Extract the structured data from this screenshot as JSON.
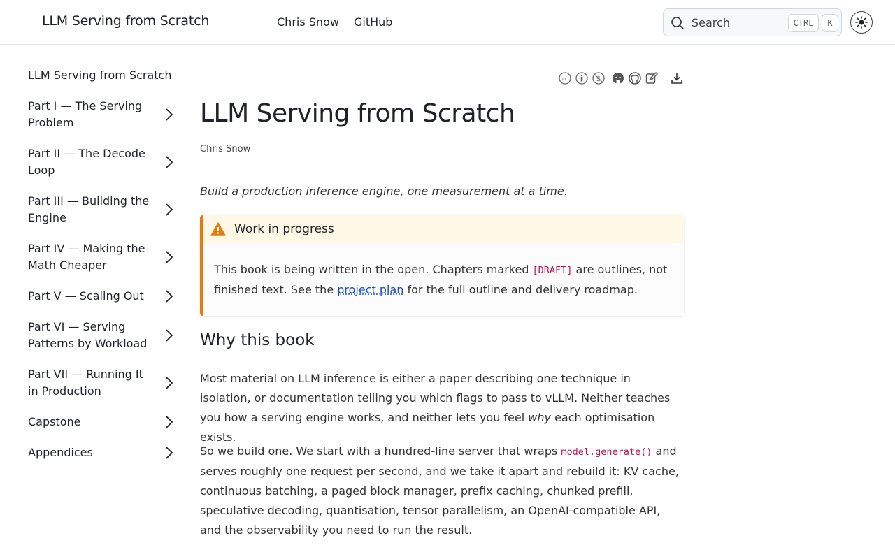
{
  "header": {
    "site_title": "LLM Serving from Scratch",
    "nav": [
      "Chris Snow",
      "GitHub"
    ],
    "search": {
      "placeholder": "Search",
      "kbd_ctrl": "CTRL",
      "kbd_k": "K"
    }
  },
  "sidebar": {
    "top": "LLM Serving from Scratch",
    "items": [
      {
        "label": "Part I — The Serving Problem"
      },
      {
        "label": "Part II — The Decode Loop"
      },
      {
        "label": "Part III — Building the Engine"
      },
      {
        "label": "Part IV — Making the Math Cheaper"
      },
      {
        "label": "Part V — Scaling Out"
      },
      {
        "label": "Part VI — Serving Patterns by Workload"
      },
      {
        "label": "Part VII — Running It in Production"
      },
      {
        "label": "Capstone"
      },
      {
        "label": "Appendices"
      }
    ]
  },
  "toolbar_icons": [
    "cc-icon",
    "by-icon",
    "nc-icon",
    "github-cat-icon",
    "github-icon",
    "edit-icon",
    "download-icon"
  ],
  "page": {
    "title": "LLM Serving from Scratch",
    "author": "Chris Snow",
    "tagline": "Build a production inference engine, one measurement at a time.",
    "callout": {
      "title": "Work in progress",
      "text_1": "This book is being written in the open. Chapters marked ",
      "code": "[DRAFT]",
      "text_2": " are outlines, not finished text. See the ",
      "link": "project plan",
      "text_3": " for the full outline and delivery roadmap."
    },
    "section_title": "Why this book",
    "p1_a": "Most material on LLM inference is either a paper describing one technique in isolation, or documentation telling you which flags to pass to vLLM. Neither teaches you how a serving engine works, and neither lets you feel ",
    "p1_em": "why",
    "p1_b": " each optimisation exists.",
    "p2_a": "So we build one. We start with a hundred-line server that wraps ",
    "p2_code": "model.generate()",
    "p2_b": " and serves roughly one request per second, and we take it apart and rebuild it: KV cache, continuous batching, a paged block manager, prefix caching, chunked prefill, speculative decoding, quantisation, tensor parallelism, an OpenAI-compatible API, and the observability you need to run the result."
  },
  "colors": {
    "accent_warning": "#e37e0c",
    "link": "#1d4eb8",
    "code": "#b5155e"
  }
}
